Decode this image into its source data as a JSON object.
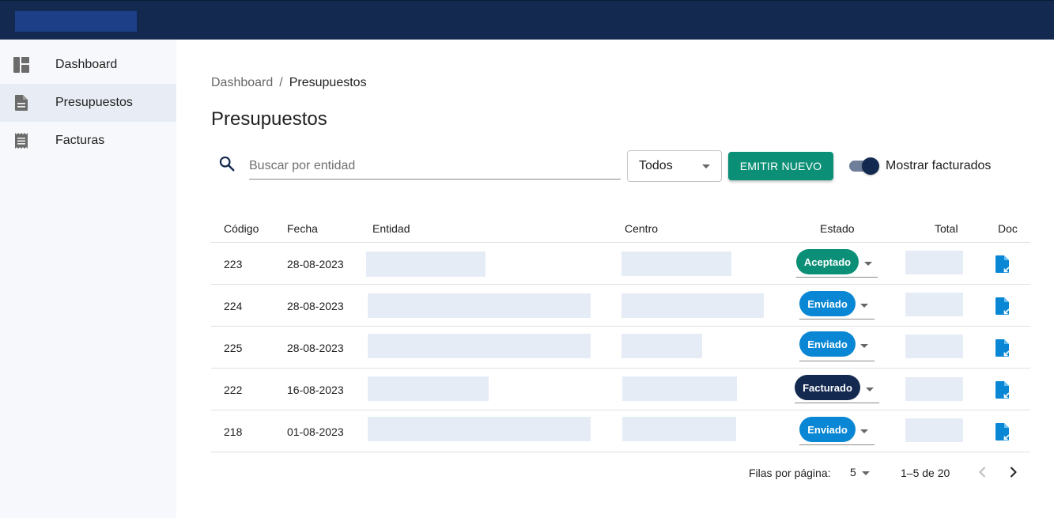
{
  "colors": {
    "topbar": "#13294f",
    "accent_green": "#0b8f76",
    "chip_aceptado": "#0b8f76",
    "chip_enviado": "#0a87d4",
    "chip_facturado": "#13294f",
    "doc_icon": "#0a87d4"
  },
  "sidebar": {
    "items": [
      {
        "label": "Dashboard",
        "icon": "dashboard-icon",
        "active": false
      },
      {
        "label": "Presupuestos",
        "icon": "document-icon",
        "active": true
      },
      {
        "label": "Facturas",
        "icon": "receipt-icon",
        "active": false
      }
    ]
  },
  "breadcrumb": {
    "parent": "Dashboard",
    "separator": "/",
    "current": "Presupuestos"
  },
  "page": {
    "title": "Presupuestos"
  },
  "toolbar": {
    "search_placeholder": "Buscar por entidad",
    "search_value": "",
    "filter_value": "Todos",
    "emit_button": "EMITIR NUEVO",
    "toggle_label": "Mostrar facturados",
    "toggle_on": true
  },
  "table": {
    "columns": [
      "Código",
      "Fecha",
      "Entidad",
      "Centro",
      "Estado",
      "Total",
      "Doc"
    ],
    "rows": [
      {
        "codigo": "223",
        "fecha": "28-08-2023",
        "estado": "Aceptado"
      },
      {
        "codigo": "224",
        "fecha": "28-08-2023",
        "estado": "Enviado"
      },
      {
        "codigo": "225",
        "fecha": "28-08-2023",
        "estado": "Enviado"
      },
      {
        "codigo": "222",
        "fecha": "16-08-2023",
        "estado": "Facturado"
      },
      {
        "codigo": "218",
        "fecha": "01-08-2023",
        "estado": "Enviado"
      }
    ]
  },
  "pagination": {
    "rows_per_page_label": "Filas por página:",
    "rows_per_page": "5",
    "range": "1–5 de 20"
  }
}
